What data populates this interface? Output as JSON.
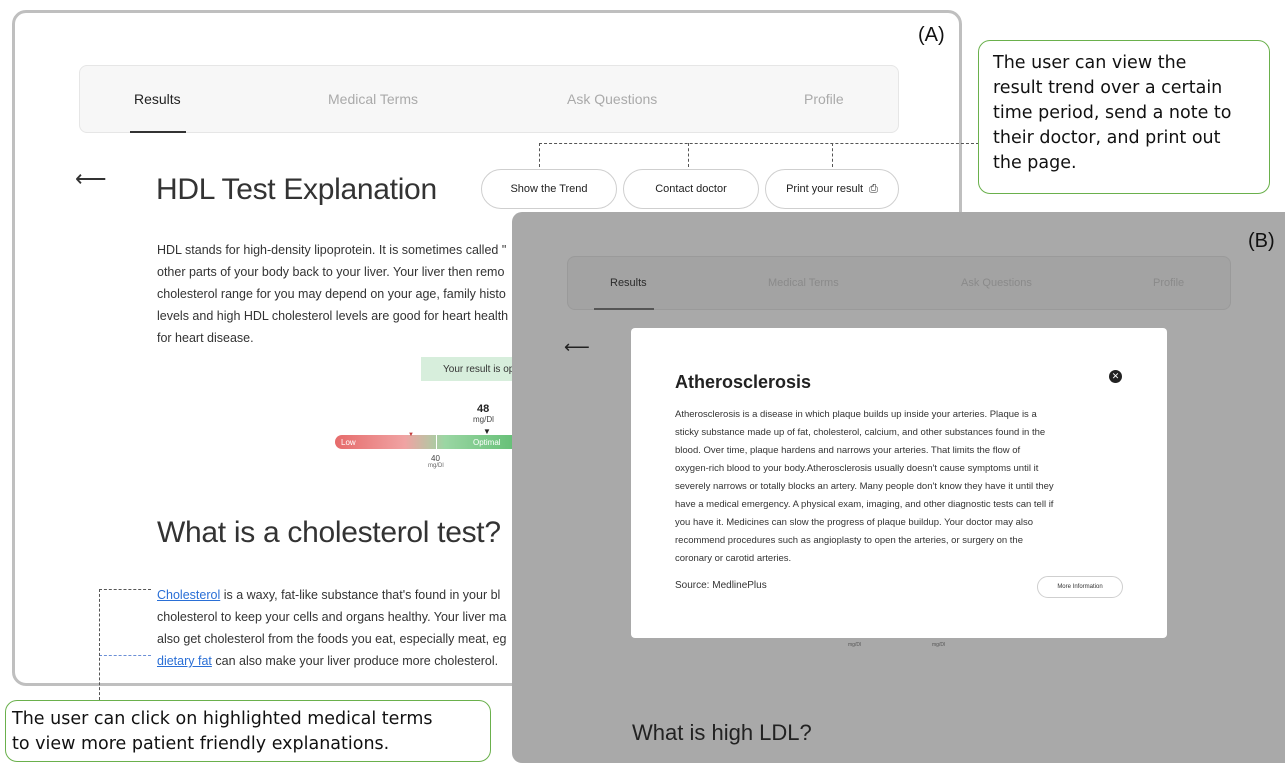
{
  "panel_a": {
    "label": "(A)",
    "nav": {
      "tabs": [
        "Results",
        "Medical Terms",
        "Ask Questions",
        "Profile"
      ]
    },
    "back_arrow": "⟵",
    "page_title": "HDL Test Explanation",
    "actions": {
      "trend_label": "Show the Trend",
      "contact_label": "Contact doctor",
      "print_label": "Print your result",
      "print_icon": "⎙"
    },
    "intro_lines": [
      "HDL stands for high-density lipoprotein. It is sometimes called \"",
      "other parts of your body back to your liver. Your liver then remo",
      "cholesterol range for you may depend on your age, family histo",
      "levels and high HDL cholesterol levels are good for heart health",
      "for heart disease."
    ],
    "result_chip": "Your result is opt",
    "gauge": {
      "value": "48",
      "unit": "mg/Dl",
      "marker": "▼",
      "low_label": "Low",
      "optimal_label": "Optimal",
      "tick_marker": "▼",
      "threshold": "40",
      "threshold_unit": "mg/Dl"
    },
    "section_title": "What is a cholesterol test?",
    "para": {
      "line1_link": "Cholesterol",
      "line1_rest": " is a waxy, fat-like substance that's found in your bl",
      "line2": "cholesterol to keep your cells and organs healthy. Your liver ma",
      "line3": "also get cholesterol from the foods you eat, especially meat, eg",
      "line4_link": "dietary fat",
      "line4_rest": " can also make your liver produce more cholesterol."
    }
  },
  "callouts": {
    "top_right": [
      "The user can view the",
      "result trend over a certain",
      "time period, send a note to",
      "their doctor, and print out",
      "the page."
    ],
    "bottom_left": [
      "The user can click on highlighted medical terms",
      "to view more patient friendly explanations."
    ]
  },
  "panel_b": {
    "label": "(B)",
    "nav": {
      "tabs": [
        "Results",
        "Medical Terms",
        "Ask Questions",
        "Profile"
      ]
    },
    "back_arrow": "⟵",
    "faint_unit_1": "mg/Dl",
    "faint_unit_2": "mg/Dl",
    "bottom_title": "What is high LDL?",
    "modal": {
      "title": "Atherosclerosis",
      "close_icon": "✕",
      "lines": [
        "Atherosclerosis is a disease in which plaque builds up inside your arteries. Plaque is a",
        "sticky substance made up of fat, cholesterol, calcium, and other substances found in the",
        "blood. Over time, plaque hardens and narrows your arteries. That limits the flow of",
        "oxygen-rich blood to your body.Atherosclerosis usually doesn't cause symptoms until it",
        "severely narrows or totally blocks an artery. Many people don't know they have it until they",
        "have a medical emergency. A physical exam, imaging, and other diagnostic tests can tell if",
        "you have it. Medicines can slow the progress of plaque buildup. Your doctor may also",
        "recommend procedures such as angioplasty to open the arteries, or surgery on the",
        "coronary or carotid arteries."
      ],
      "source": "Source:  MedlinePlus",
      "more_label": "More Information"
    }
  }
}
